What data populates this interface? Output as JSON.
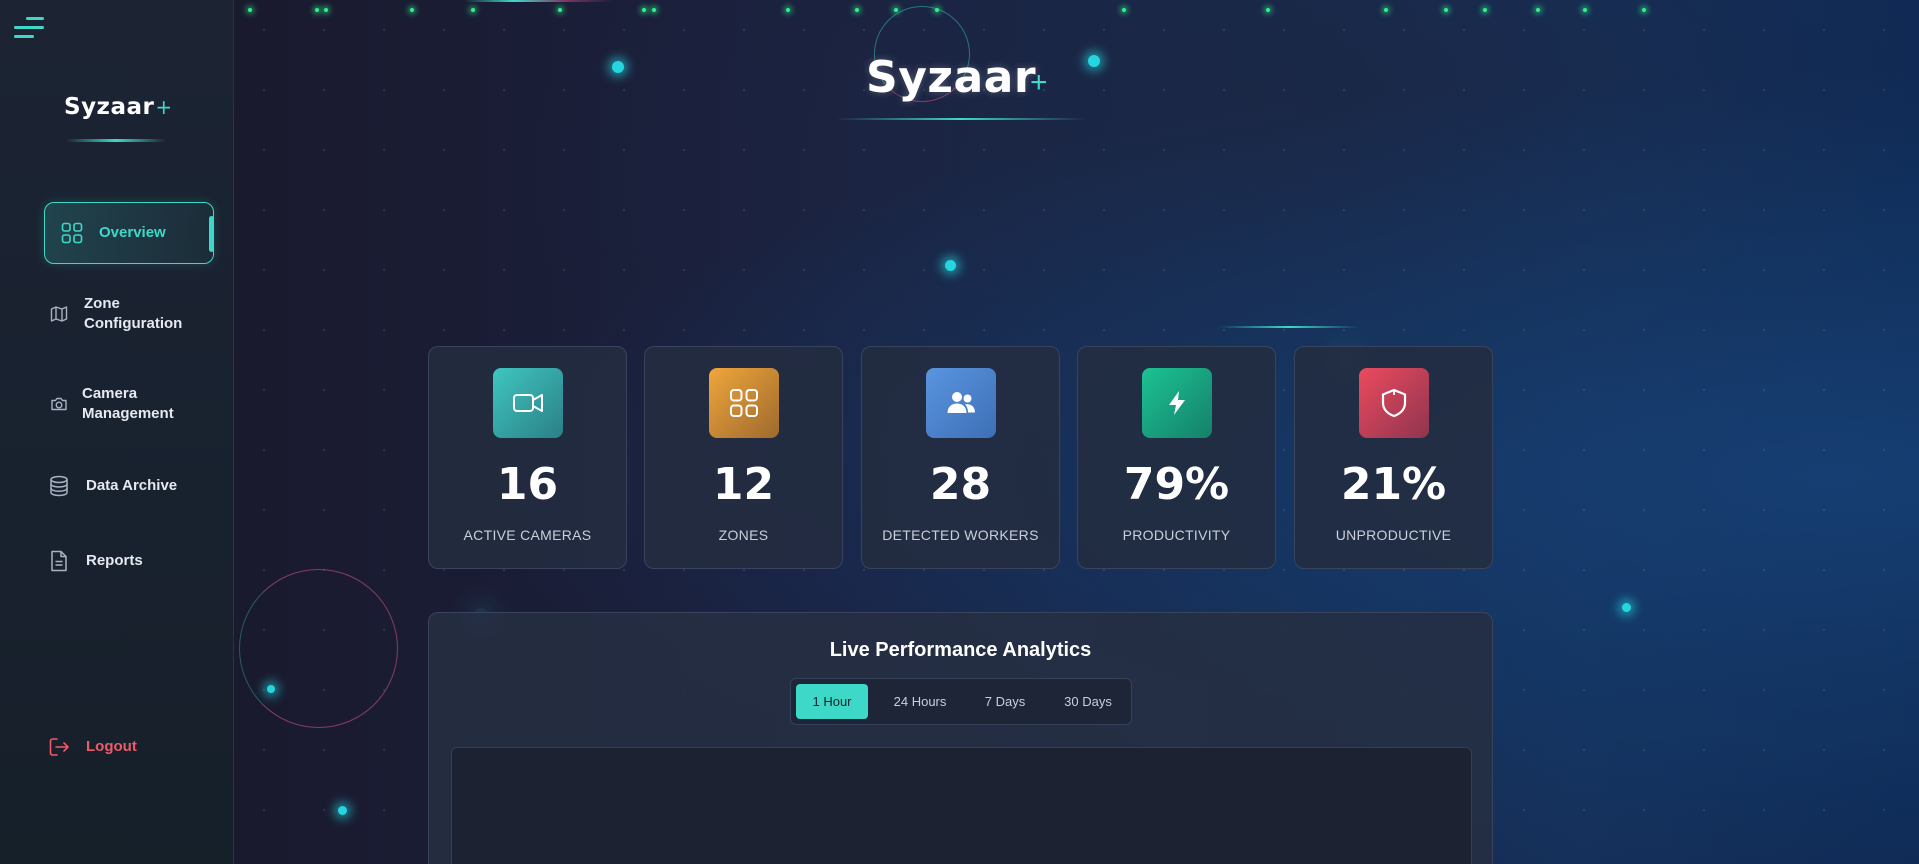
{
  "app": {
    "brand_name": "Syzaar",
    "brand_plus": "+"
  },
  "sidebar": {
    "logo": "Syzaar",
    "logo_plus": "+",
    "items": [
      {
        "label": "Overview",
        "icon": "grid-icon",
        "active": true
      },
      {
        "label": "Zone Configuration",
        "icon": "map-icon",
        "active": false
      },
      {
        "label": "Camera Management",
        "icon": "camera-icon",
        "active": false
      },
      {
        "label": "Data Archive",
        "icon": "database-icon",
        "active": false
      },
      {
        "label": "Reports",
        "icon": "document-icon",
        "active": false
      }
    ],
    "logout_label": "Logout"
  },
  "stats": [
    {
      "value": "16",
      "label": "ACTIVE CAMERAS",
      "icon": "video-camera-icon",
      "color": "#3ab7b5"
    },
    {
      "value": "12",
      "label": "ZONES",
      "icon": "grid-icon",
      "color": "#e39a33"
    },
    {
      "value": "28",
      "label": "DETECTED WORKERS",
      "icon": "users-icon",
      "color": "#4a86d4"
    },
    {
      "value": "79%",
      "label": "PRODUCTIVITY",
      "icon": "lightning-icon",
      "color": "#17b98a"
    },
    {
      "value": "21%",
      "label": "UNPRODUCTIVE",
      "icon": "shield-icon",
      "color": "#e0465c"
    }
  ],
  "analytics": {
    "title": "Live Performance Analytics",
    "tabs": [
      {
        "label": "1 Hour",
        "active": true
      },
      {
        "label": "24 Hours",
        "active": false
      },
      {
        "label": "7 Days",
        "active": false
      },
      {
        "label": "30 Days",
        "active": false
      }
    ]
  },
  "colors": {
    "accent": "#3ed8c8",
    "logout": "#ef5a6b",
    "background": "#151a2b"
  }
}
